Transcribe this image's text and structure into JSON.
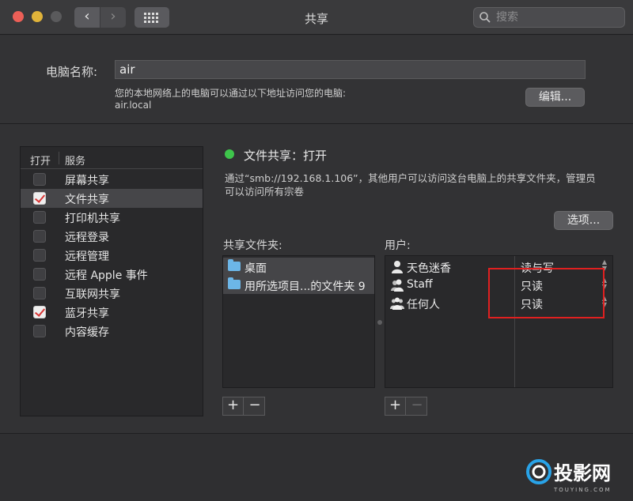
{
  "window": {
    "title": "共享"
  },
  "search": {
    "placeholder": "搜索"
  },
  "computer": {
    "name_label": "电脑名称:",
    "name_value": "air",
    "description_line1": "您的本地网络上的电脑可以通过以下地址访问您的电脑:",
    "description_line2": "air.local",
    "edit_label": "编辑..."
  },
  "services": {
    "header_open": "打开",
    "header_service": "服务",
    "items": [
      {
        "label": "屏幕共享",
        "checked": false
      },
      {
        "label": "文件共享",
        "checked": true,
        "selected": true
      },
      {
        "label": "打印机共享",
        "checked": false
      },
      {
        "label": "远程登录",
        "checked": false
      },
      {
        "label": "远程管理",
        "checked": false
      },
      {
        "label": "远程 Apple 事件",
        "checked": false
      },
      {
        "label": "互联网共享",
        "checked": false
      },
      {
        "label": "蓝牙共享",
        "checked": true
      },
      {
        "label": "内容缓存",
        "checked": false
      }
    ]
  },
  "file_sharing": {
    "status": "文件共享：打开",
    "status_color": "#3ec54b",
    "info_line1": "通过“smb://192.168.1.106”，其他用户可以访问这台电脑上的共享文件夹，管理员",
    "info_line2": "可以访问所有宗卷",
    "options_label": "选项...",
    "folders_label": "共享文件夹:",
    "users_label": "用户:",
    "folders": [
      {
        "label": "桌面"
      },
      {
        "label": "用所选项目...的文件夹 9"
      }
    ],
    "users": [
      {
        "name": "天色迷香",
        "permission": "读与写",
        "icon": "single-user-icon"
      },
      {
        "name": "Staff",
        "permission": "只读",
        "icon": "staff-group-icon"
      },
      {
        "name": "任何人",
        "permission": "只读",
        "icon": "everyone-group-icon"
      }
    ],
    "highlight_color": "#e02020"
  },
  "controls": {
    "plus": "+",
    "minus": "−"
  },
  "watermark": {
    "text": "投影网",
    "subtext": "TOUYING.COM"
  }
}
